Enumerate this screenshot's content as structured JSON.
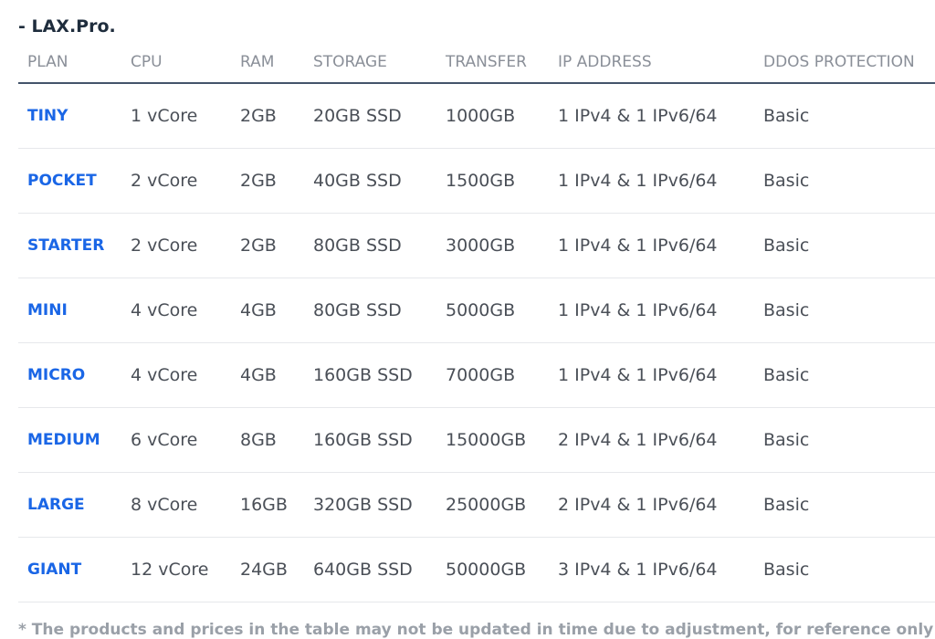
{
  "section": {
    "title": "- LAX.Pro."
  },
  "table": {
    "headers": [
      "PLAN",
      "CPU",
      "RAM",
      "STORAGE",
      "TRANSFER",
      "IP ADDRESS",
      "DDOS PROTECTION"
    ],
    "rows": [
      [
        "TINY",
        "1 vCore",
        "2GB",
        "20GB SSD",
        "1000GB",
        "1 IPv4 & 1 IPv6/64",
        "Basic"
      ],
      [
        "POCKET",
        "2 vCore",
        "2GB",
        "40GB SSD",
        "1500GB",
        "1 IPv4 & 1 IPv6/64",
        "Basic"
      ],
      [
        "STARTER",
        "2 vCore",
        "2GB",
        "80GB SSD",
        "3000GB",
        "1 IPv4 & 1 IPv6/64",
        "Basic"
      ],
      [
        "MINI",
        "4 vCore",
        "4GB",
        "80GB SSD",
        "5000GB",
        "1 IPv4 & 1 IPv6/64",
        "Basic"
      ],
      [
        "MICRO",
        "4 vCore",
        "4GB",
        "160GB SSD",
        "7000GB",
        "1 IPv4 & 1 IPv6/64",
        "Basic"
      ],
      [
        "MEDIUM",
        "6 vCore",
        "8GB",
        "160GB SSD",
        "15000GB",
        "2 IPv4 & 1 IPv6/64",
        "Basic"
      ],
      [
        "LARGE",
        "8 vCore",
        "16GB",
        "320GB SSD",
        "25000GB",
        "2 IPv4 & 1 IPv6/64",
        "Basic"
      ],
      [
        "GIANT",
        "12 vCore",
        "24GB",
        "640GB SSD",
        "50000GB",
        "3 IPv4 & 1 IPv6/64",
        "Basic"
      ]
    ]
  },
  "footnote": "* The products and prices in the table may not be updated in time due to adjustment, for reference only",
  "colors": {
    "plan_link": "#1a66e6",
    "header_text": "#8a8f98",
    "header_rule": "#44546a",
    "row_divider": "#e6e8eb",
    "title": "#1f2d3d"
  }
}
